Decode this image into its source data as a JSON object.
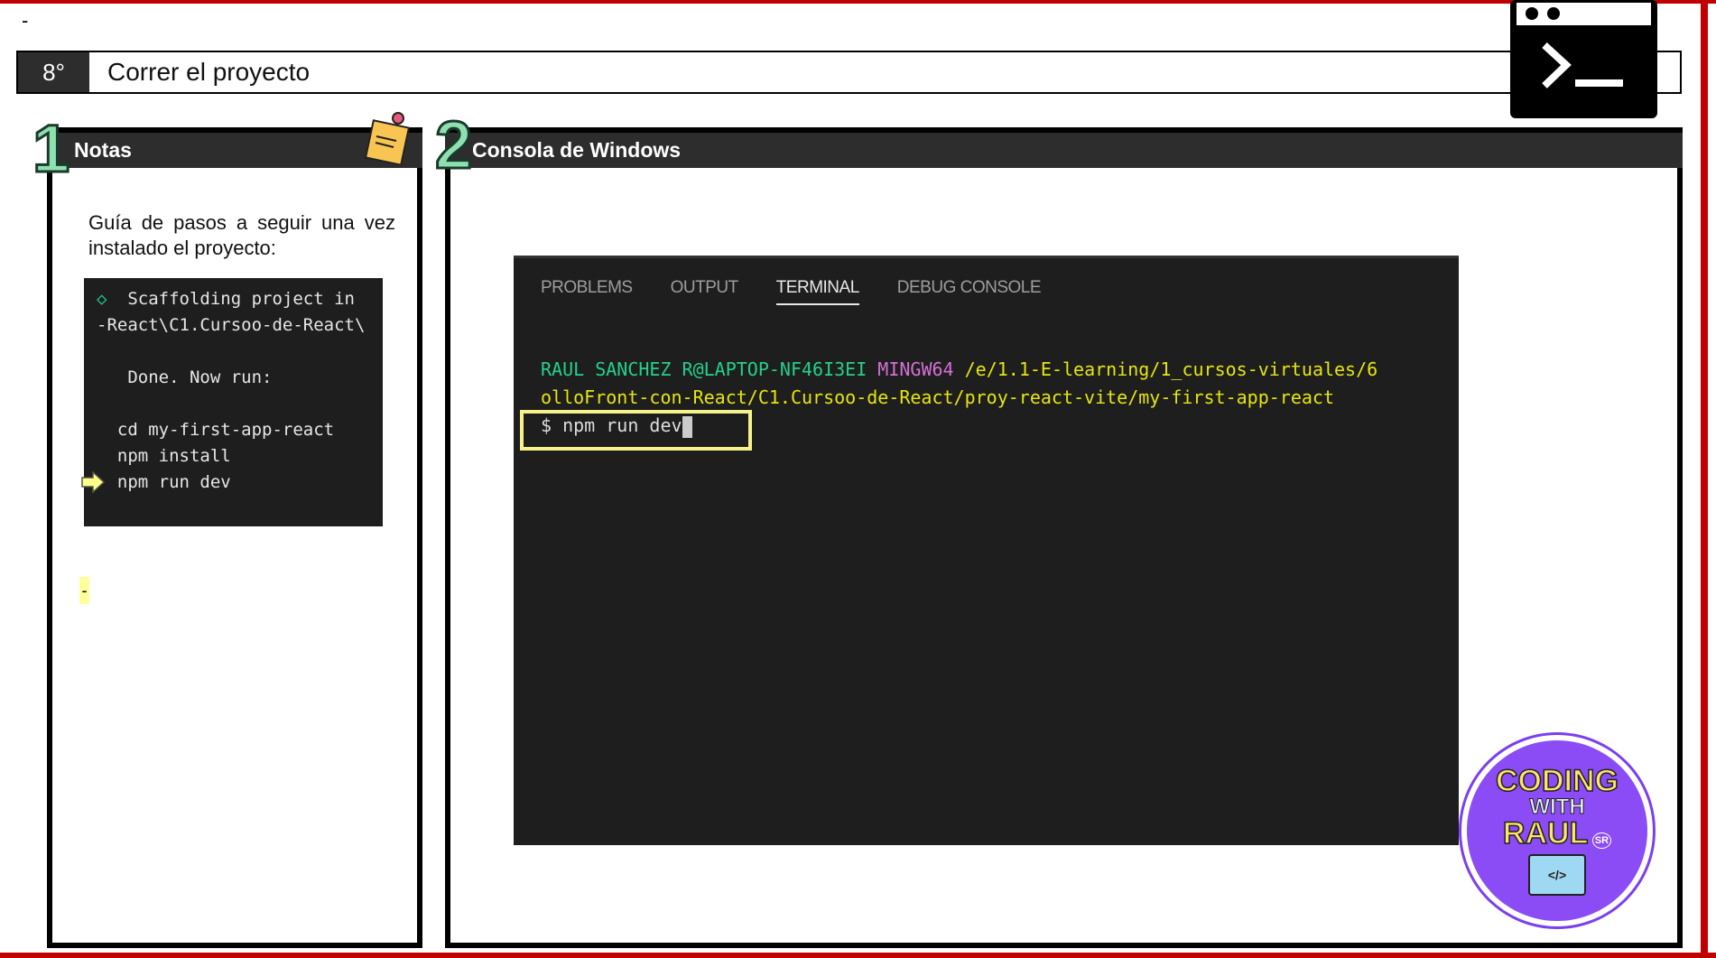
{
  "top_dash": "-",
  "header": {
    "step": "8°",
    "title": "Correr el proyecto"
  },
  "panel1": {
    "number": "1",
    "title": "Notas",
    "text": "Guía de pasos a seguir una vez instalado el proyecto:",
    "code_lines": [
      "◇  Scaffolding project in",
      "-React\\C1.Cursoo-de-React\\",
      "",
      "   Done. Now run:",
      "",
      "  cd my-first-app-react",
      "  npm install",
      "  npm run dev"
    ],
    "marker": "-"
  },
  "panel2": {
    "number": "2",
    "title": "Consola de Windows",
    "tabs": [
      "PROBLEMS",
      "OUTPUT",
      "TERMINAL",
      "DEBUG CONSOLE"
    ],
    "active_tab": "TERMINAL",
    "prompt_user": "RAUL SANCHEZ R@LAPTOP-NF46I3EI",
    "prompt_env": "MINGW64",
    "prompt_path1": "/e/1.1-E-learning/1_cursos-virtuales/6",
    "prompt_path2": "olloFront-con-React/C1.Cursoo-de-React/proy-react-vite/my-first-app-react",
    "command": "$ npm run dev"
  },
  "logo": {
    "line1": "CODING",
    "line2": "WITH",
    "line3": "RAUL",
    "badge": "SR",
    "icon": "</>"
  }
}
